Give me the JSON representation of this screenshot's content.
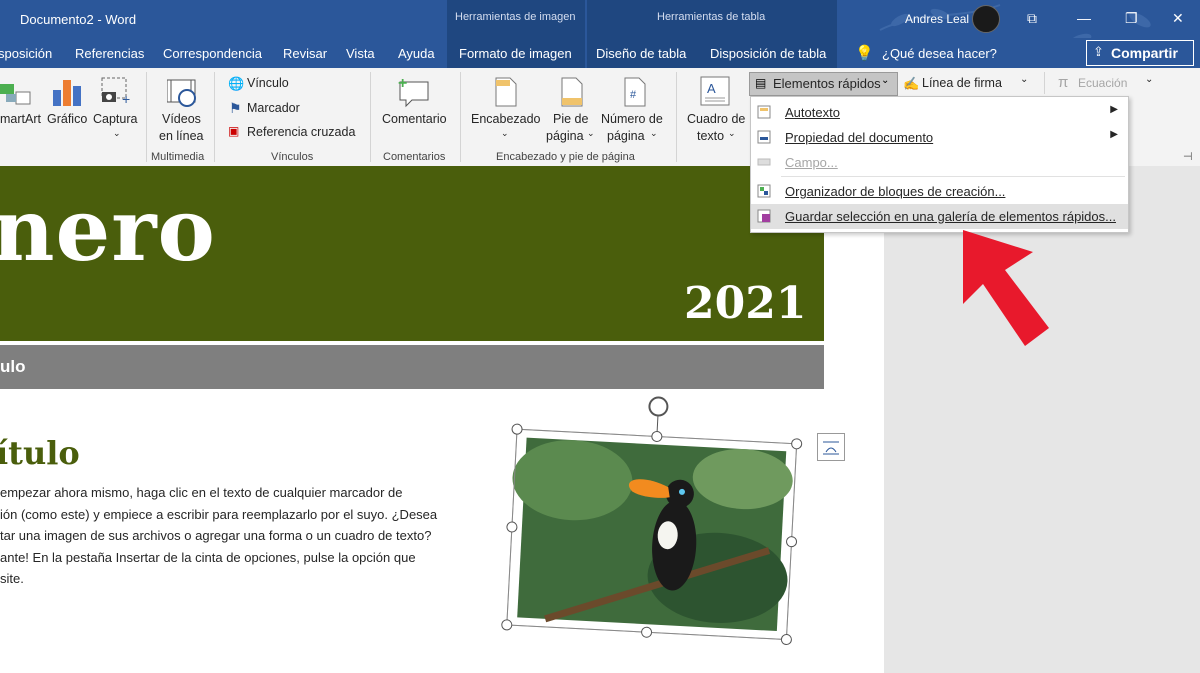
{
  "window": {
    "title": "Documento2 - Word",
    "user": "Andres Leal",
    "context_image_tools": "Herramientas de imagen",
    "context_table_tools": "Herramientas de tabla",
    "help_search": "¿Qué desea hacer?",
    "share": "Compartir"
  },
  "tabs": [
    "sposición",
    "Referencias",
    "Correspondencia",
    "Revisar",
    "Vista",
    "Ayuda",
    "Formato de imagen",
    "Diseño de tabla",
    "Disposición de tabla"
  ],
  "ribbon": {
    "smartart": "martArt",
    "grafico": "Gráfico",
    "captura": "Captura",
    "videos1": "Vídeos",
    "videos2": "en línea",
    "group_multimedia": "Multimedia",
    "vinculo": "Vínculo",
    "marcador": "Marcador",
    "ref_cruzada": "Referencia cruzada",
    "group_vinculos": "Vínculos",
    "comentario": "Comentario",
    "group_comentarios": "Comentarios",
    "encabezado": "Encabezado",
    "pie1": "Pie de",
    "pie2": "página",
    "num1": "Número de",
    "num2": "página",
    "group_enc": "Encabezado y pie de página",
    "cuadro1": "Cuadro de",
    "cuadro2": "texto",
    "elementos_rapidos": "Elementos rápidos",
    "linea_firma": "Línea de firma",
    "ecuacion": "Ecuación"
  },
  "menu": {
    "autotexto": "Autotexto",
    "propiedad": "Propiedad del documento",
    "campo": "Campo...",
    "organizador": "Organizador de bloques de creación...",
    "guardar": "Guardar selección en una galería de elementos rápidos..."
  },
  "document": {
    "title": "nero",
    "year": "2021",
    "subtitle": "ulo",
    "heading": "ítulo",
    "body_lines": [
      "empezar ahora mismo, haga clic en el texto de cualquier marcador de",
      "ión (como este) y empiece a escribir para reemplazarlo por el suyo. ¿Desea",
      "tar una imagen de sus archivos o agregar una forma o un cuadro de texto?",
      "ante! En la pestaña Insertar de la cinta de opciones, pulse la opción que",
      "site."
    ]
  },
  "colors": {
    "title_bar": "#2b579a",
    "green_band": "#4a5e0c",
    "gray_band": "#7f7f7f",
    "arrow": "#e8192c"
  }
}
